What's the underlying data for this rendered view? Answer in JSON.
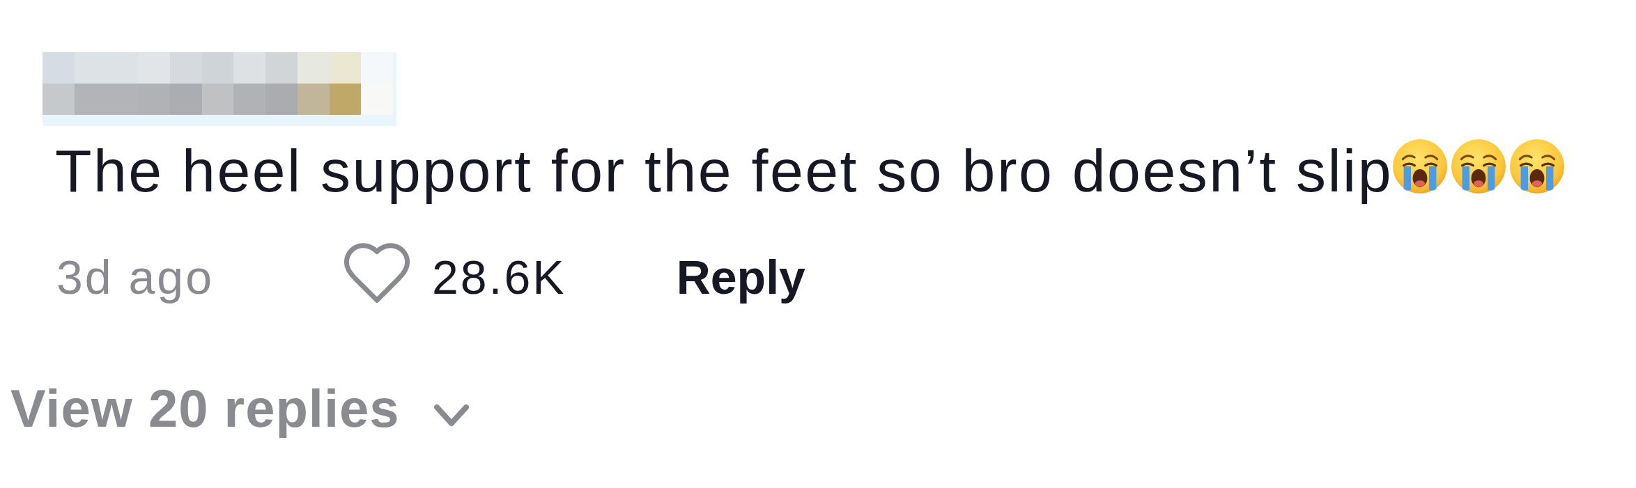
{
  "comment": {
    "text": "The heel support for the feet so bro doesn’t slip",
    "emojis": [
      {
        "kind": "crying"
      },
      {
        "kind": "crying"
      },
      {
        "kind": "crying"
      }
    ],
    "time": "3d ago",
    "likes": {
      "count": "28.6K",
      "liked": false
    },
    "reply_label": "Reply"
  },
  "replies_toggle": {
    "label": "View 20 replies",
    "expanded": false
  }
}
